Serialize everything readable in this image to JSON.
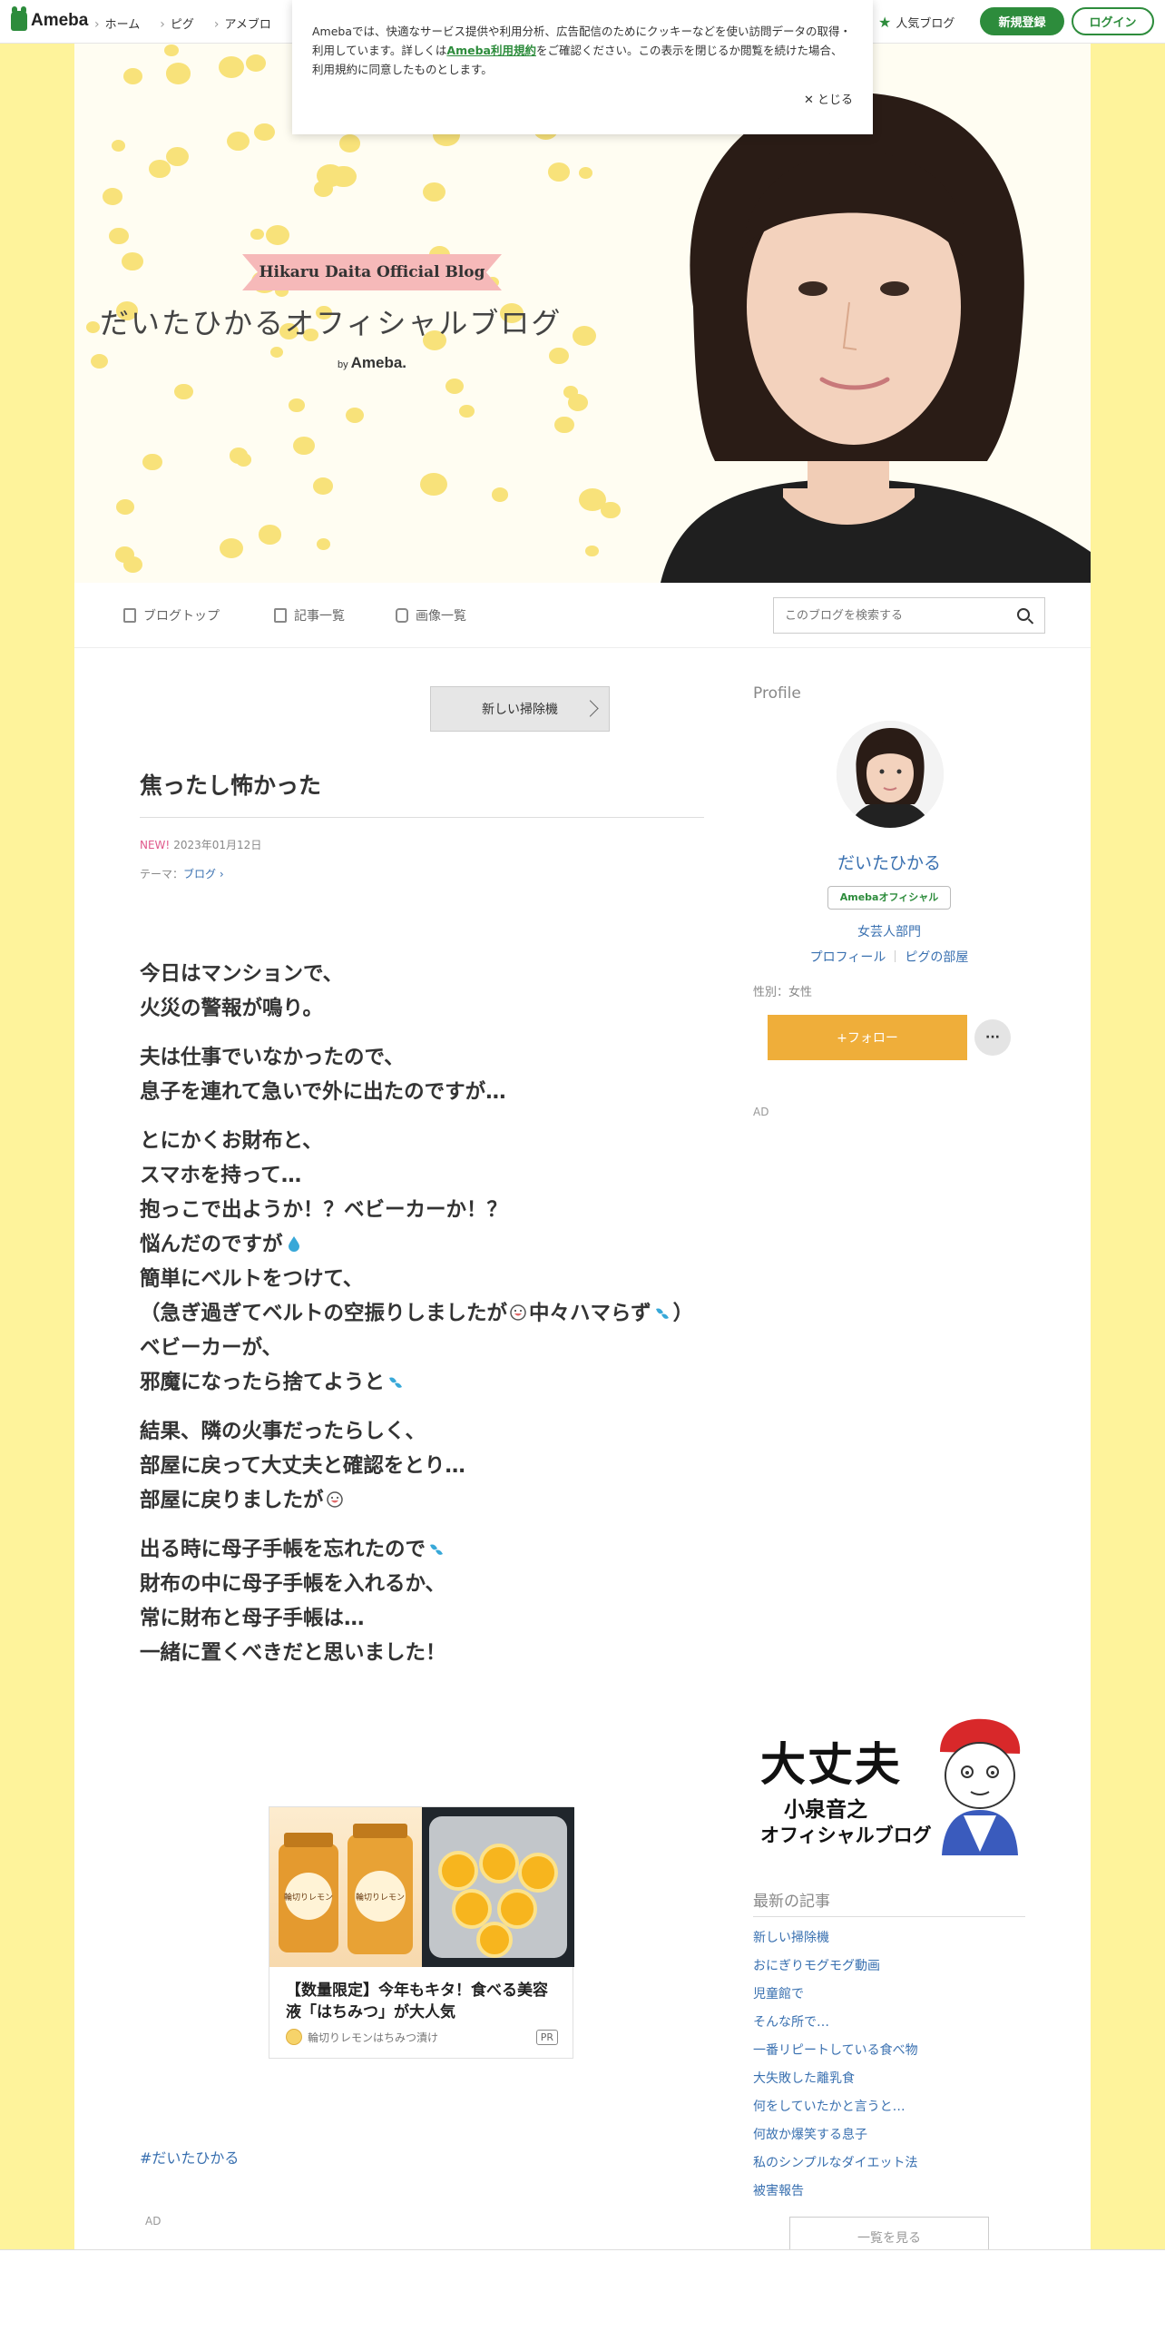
{
  "header": {
    "logo": "Ameba",
    "nav": [
      "ホーム",
      "ピグ",
      "アメブロ"
    ],
    "popular": "人気ブログ",
    "register": "新規登録",
    "login": "ログイン"
  },
  "cookie": {
    "text_before": "Amebaでは、快適なサービス提供や利用分析、広告配信のためにクッキーなどを使い訪問データの取得・利用しています。詳しくは",
    "link": "Ameba利用規約",
    "text_after": "をご確認ください。この表示を閉じるか閲覧を続けた場合、利用規約に同意したものとします。",
    "close": "とじる"
  },
  "hero": {
    "banner": "Hikaru Daita Official Blog",
    "title": "だいたひかるオフィシャルブログ",
    "by": "by",
    "brand": "Ameba."
  },
  "blognav": {
    "top": "ブログトップ",
    "list": "記事一覧",
    "images": "画像一覧",
    "search_placeholder": "このブログを検索する"
  },
  "post": {
    "next_label": "新しい掃除機",
    "title": "焦ったし怖かった",
    "new_badge": "NEW!",
    "date": "2023年01月12日",
    "theme_label": "テーマ：",
    "theme": "ブログ",
    "p1": "今日はマンションで、\n火災の警報が鳴り。",
    "p2": "夫は仕事でいなかったので、\n息子を連れて急いで外に出たのですが…",
    "p3a": "とにかくお財布と、\nスマホを持って…\n抱っこで出ようか！？ベビーカーか！？\n悩んだのですが",
    "p3b": "\n簡単にベルトをつけて、\n（急ぎ過ぎてベルトの空振りしましたが",
    "p3c": "中々ハマらず",
    "p3d": "）\nベビーカーが、\n邪魔になったら捨てようと",
    "p4a": "結果、隣の火事だったらしく、\n部屋に戻って大丈夫と確認をとり…\n部屋に戻りましたが",
    "p5a": "出る時に母子手帳を忘れたので",
    "p5b": "\n財布の中に母子手帳を入れるか、\n常に財布と母子手帳は…\n一緒に置くべきだと思いました！",
    "hashtag": "#だいたひかる",
    "ad_label": "AD"
  },
  "ad": {
    "img_label_1": "輪切りレモン",
    "img_label_2": "輪切りレモン",
    "title": "【数量限定】今年もキタ！食べる美容液「はちみつ」が大人気",
    "sponsor": "輪切りレモンはちみつ漬け",
    "pr": "PR"
  },
  "sidebar": {
    "profile_heading": "Profile",
    "name": "だいたひかる",
    "badge": "Amebaオフィシャル",
    "category": "女芸人部門",
    "link_profile": "プロフィール",
    "link_room": "ピグの部屋",
    "sex": "性別：女性",
    "follow": "+フォロー",
    "more": "···",
    "ad_label": "AD",
    "banner_main": "大丈夫",
    "banner_sub1": "小泉音之",
    "banner_sub2": "オフィシャルブログ",
    "recent_heading": "最新の記事",
    "recent": [
      "新しい掃除機",
      "おにぎりモグモグ動画",
      "児童館で",
      "そんな所で…",
      "一番リピートしている食べ物",
      "大失敗した離乳食",
      "何をしていたかと言うと…",
      "何故か爆笑する息子",
      "私のシンプルなダイエット法",
      "被害報告"
    ],
    "see_all": "一覧を見る"
  },
  "colors": {
    "accent_green": "#2d8c3c",
    "page_yellow": "#fef39b",
    "link_blue": "#3970b0",
    "follow_orange": "#efae3a"
  }
}
